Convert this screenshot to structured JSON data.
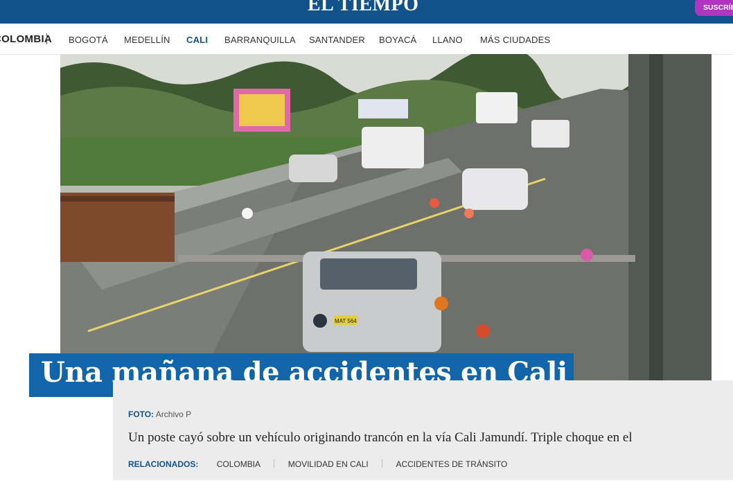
{
  "header": {
    "logo": "EL TIEMPO",
    "subscribe_label": "SUSCRÍBETE"
  },
  "nav": {
    "section": "COLOMBIA",
    "items": [
      {
        "label": "BOGOTÁ"
      },
      {
        "label": "MEDELLÍN"
      },
      {
        "label": "CALI",
        "active": true
      },
      {
        "label": "BARRANQUILLA"
      },
      {
        "label": "SANTANDER"
      },
      {
        "label": "BOYACÁ"
      },
      {
        "label": "LLANO"
      },
      {
        "label": "MÁS CIUDADES"
      }
    ]
  },
  "article": {
    "title": "Una mañana de accidentes en Cali",
    "photo_credit_label": "FOTO:",
    "photo_credit": "Archivo P",
    "summary": "Un poste cayó sobre un vehículo originando trancón en la vía Cali Jamundí. Triple choque en el",
    "plate": "MAT 564",
    "related_label": "RELACIONADOS:",
    "related": [
      "COLOMBIA",
      "MOVILIDAD EN CALI",
      "ACCIDENTES DE TRÁNSITO"
    ]
  },
  "colors": {
    "brand": "#12528a",
    "title_box": "#1265a8",
    "subscribe": "#b034c0"
  }
}
